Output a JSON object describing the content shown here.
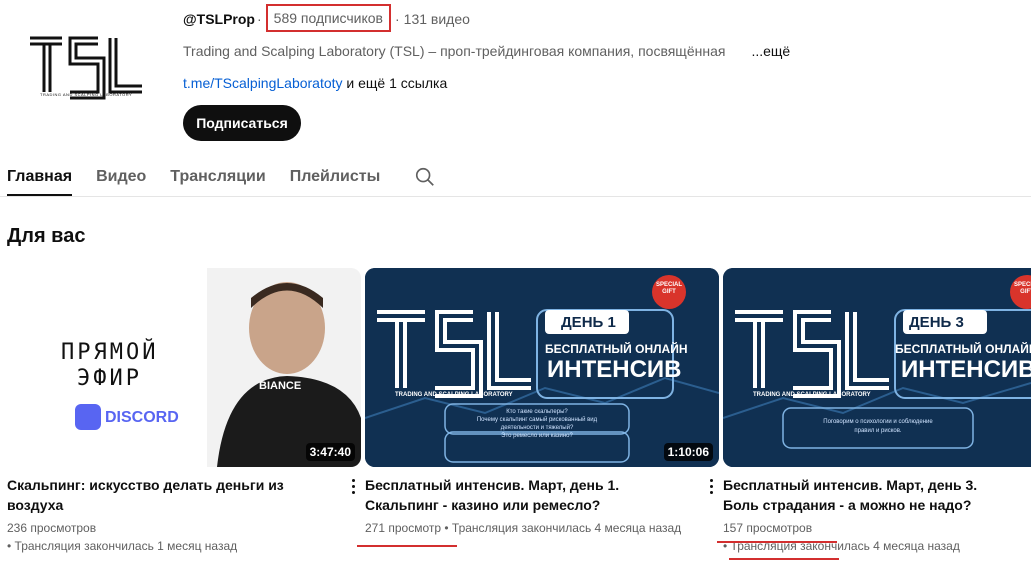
{
  "channel": {
    "logo_text": "TSL",
    "logo_subtext": "TRADING AND SCALPING LABORATORY",
    "handle": "@TSLProp",
    "separator": "·",
    "subscribers": "589 подписчиков",
    "videos_count": "131 видео",
    "description": "Trading and Scalping Laboratory (TSL) – проп-трейдинговая компания, посвящённая",
    "more_label": "...ещё",
    "link": "t.me/TScalpingLaboratoty",
    "more_links": "и ещё 1 ссылка",
    "subscribe_label": "Подписаться"
  },
  "tabs": [
    {
      "label": "Главная",
      "active": true
    },
    {
      "label": "Видео",
      "active": false
    },
    {
      "label": "Трансляции",
      "active": false
    },
    {
      "label": "Плейлисты",
      "active": false
    }
  ],
  "search_icon": "search-icon",
  "section_title": "Для вас",
  "videos": [
    {
      "title": "Скальпинг: искусство делать деньги из воздуха",
      "views": "236 просмотров",
      "meta": "Трансляция закончилась 1 месяц назад",
      "duration": "3:47:40",
      "thumb_text": [
        "ПРЯМОЙ",
        "ЭФИР",
        "DISCORD",
        "BIANCE"
      ]
    },
    {
      "title": "Бесплатный интенсив. Март, день 1. Скальпинг - казино или ремесло?",
      "views": "271 просмотр",
      "meta": "Трансляция закончилась 4 месяца назад",
      "duration": "1:10:06",
      "thumb_text": [
        "TSL",
        "TRADING AND SCALPING LABORATORY",
        "ДЕНЬ 1",
        "БЕСПЛАТНЫЙ ОНЛАЙН",
        "ИНТЕНСИВ",
        "SPECIAL GIFT",
        "Кто такие скальперы?",
        "Почему скальпинг самый рискованный вид",
        "деятельности и тяжелый?",
        "Это ремесло или казино?"
      ]
    },
    {
      "title": "Бесплатный интенсив. Март, день 3. Боль страдания - а можно не надо?",
      "views": "157 просмотров",
      "meta": "Трансляция закончилась 4 месяца назад",
      "duration": "",
      "thumb_text": [
        "TSL",
        "TRADING AND SCALPING LABORATORY",
        "ДЕНЬ 3",
        "БЕСПЛАТНЫЙ ОНЛАЙН",
        "ИНТЕНСИВ",
        "SPECIAL GIFT",
        "Поговорим о психологии и соблюдение",
        "правил и рисков."
      ]
    }
  ],
  "colors": {
    "highlight_red": "#d32f2f",
    "link_blue": "#065fd4",
    "thumb_navy": "#0f2a4a"
  }
}
